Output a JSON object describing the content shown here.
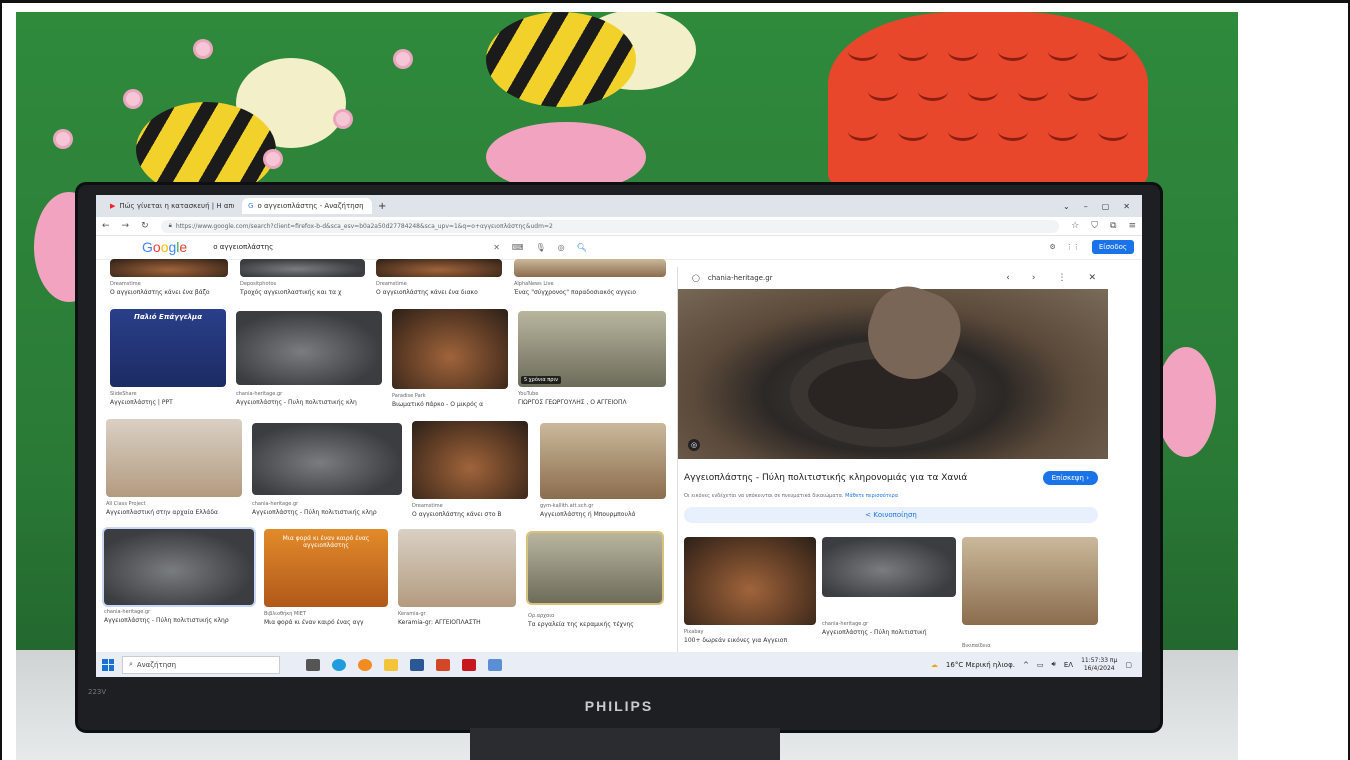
{
  "browser": {
    "tabs": [
      {
        "label": "Πώς γίνεται η κατασκευή | Η απο…",
        "active": false
      },
      {
        "label": "ο αγγειοπλάστης - Αναζήτηση",
        "active": true
      }
    ],
    "url": "https://www.google.com/search?client=firefox-b-d&sca_esv=b0a2a50d27784248&sca_upv=1&q=ο+αγγειοπλάστης&udm=2"
  },
  "google": {
    "logo": [
      "G",
      "o",
      "o",
      "g",
      "l",
      "e"
    ],
    "query": "ο αγγειοπλάστης",
    "signin_label": "Είσοδος"
  },
  "results": [
    {
      "src": "Dreamstime",
      "cap": "Ο αγγειοπλάστης κάνει ένα βάζο"
    },
    {
      "src": "Depositphotos",
      "cap": "Τροχός αγγειοπλαστικής και τα χ"
    },
    {
      "src": "Dreamstime",
      "cap": "Ο αγγειοπλάστης κάνει ένα διακο"
    },
    {
      "src": "AlphaNews Live",
      "cap": "Ένας \"σύγχρονος\" παραδοσιακός αγγειο"
    },
    {
      "src": "SlideShare",
      "cap": "Αγγειοπλάστης | PPT",
      "sign": "Παλιό Επάγγελμα"
    },
    {
      "src": "chania-heritage.gr",
      "cap": "Αγγειοπλάστης - Πυλη πολιτιστικής κλη"
    },
    {
      "src": "Paradise Park",
      "cap": "Βιωματικό πάρκο - Ο μικρός α"
    },
    {
      "src": "YouTube",
      "cap": "ΓΙΩΡΓΟΣ ΓΕΩΡΓΟΥΛΗΣ , Ο ΑΓΓΕΙΟΠΛ",
      "badge": "5 χρόνια πριν"
    },
    {
      "src": "All Class Project",
      "cap": "Αγγειοπλαστική στην αρχαία Ελλάδα"
    },
    {
      "src": "chania-heritage.gr",
      "cap": "Αγγειοπλάστης - Πύλη πολιτιστικής κληρ"
    },
    {
      "src": "Dreamstime",
      "cap": "Ο αγγειοπλάστης κάνει στο Β"
    },
    {
      "src": "gym-kallith.att.sch.gr",
      "cap": "Αγγειοπλάστης ή Μπουρμπουλά"
    },
    {
      "src": "chania-heritage.gr",
      "cap": "Αγγειοπλάστης - Πύλη πολιτιστικής κληρ"
    },
    {
      "src": "Βιβλιοθήκη ΜΙΕΤ",
      "cap": "Μια φορά κι έναν καιρό ένας αγγ",
      "sign": "Μια φορά κι έναν καιρό ένας αγγειοπλάστης"
    },
    {
      "src": "Keramia-gr",
      "cap": "Keramia-gr: ΑΓΓΕΙΟΠΛΑΣΤΗ"
    },
    {
      "src": "Ορ.αρχαια",
      "cap": "Τα εργαλεία της κεραμικής τέχνης"
    }
  ],
  "panel": {
    "site": "chania-heritage.gr",
    "title": "Αγγειοπλάστης - Πύλη πολιτιστικής κληρονομιάς για τα Χανιά",
    "visit_label": "Επίσκεψη",
    "note": "Οι εικόνες ενδέχεται να υπόκεινται σε πνευματικά δικαιώματα.",
    "note_more": "Μάθετε περισσότερα",
    "share_label": "Κοινοποίηση",
    "related": [
      {
        "src": "Pixabay",
        "cap": "100+ δωρεάν εικόνες για Αγγειοπ"
      },
      {
        "src": "chania-heritage.gr",
        "cap": "Αγγειοπλάστης - Πύλη πολιτιστική"
      },
      {
        "src": "Βικιπαίδεια",
        "cap": ""
      }
    ]
  },
  "taskbar": {
    "search_placeholder": "Αναζήτηση",
    "weather": "16°C Μερική ηλιοφ.",
    "lang": "ΕΛ",
    "time": "11:57:33 πμ",
    "date": "16/4/2024"
  },
  "monitor": {
    "brand": "PHILIPS",
    "model": "223V"
  }
}
